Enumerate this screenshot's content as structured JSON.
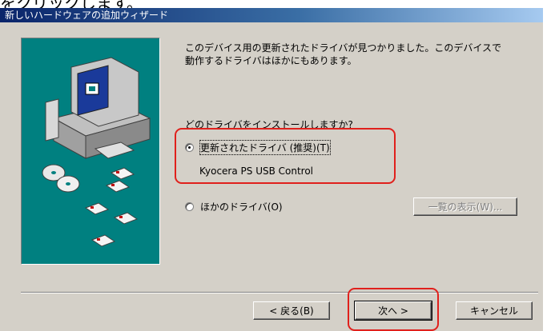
{
  "caption": "をクリックします。",
  "window": {
    "title": "新しいハードウェアの追加ウィザード"
  },
  "message": {
    "line1": "このデバイス用の更新されたドライバが見つかりました。このデバイスで",
    "line2": "動作するドライバはほかにもあります。"
  },
  "question": "どのドライバをインストールしますか?",
  "options": {
    "updated": {
      "label": "更新されたドライバ (推奨)(T)",
      "selected": true,
      "driver": "Kyocera PS USB Control"
    },
    "other": {
      "label": "ほかのドライバ(O)",
      "selected": false
    }
  },
  "buttons": {
    "show_list": "一覧の表示(W)...",
    "back": "< 戻る(B)",
    "next": "次へ >",
    "cancel": "キャンセル"
  },
  "colors": {
    "highlight": "#e0201c",
    "panel": "#008080",
    "titlebar": "#0a246a"
  }
}
